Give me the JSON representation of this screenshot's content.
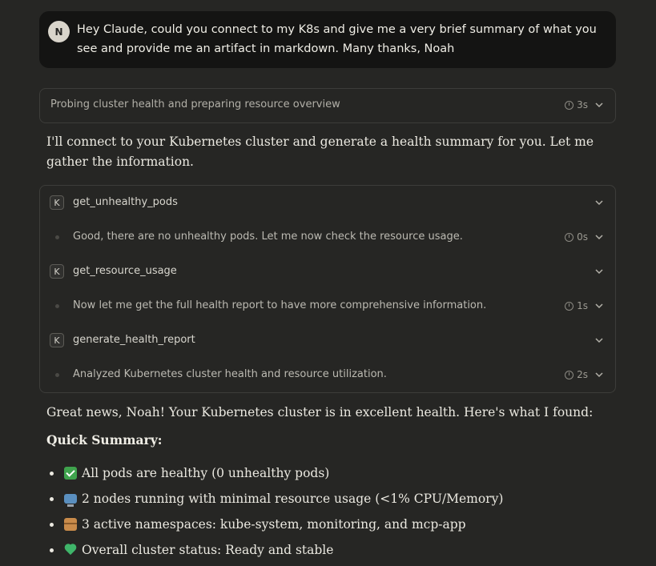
{
  "user_message": {
    "avatar_initial": "N",
    "text": "Hey Claude, could you connect to my K8s and give me a very brief summary of what you see and provide me an artifact in markdown. Many thanks, Noah"
  },
  "thinking": {
    "label": "Probing cluster health and preparing resource overview",
    "duration": "3s"
  },
  "intro": "I'll connect to your Kubernetes cluster and generate a health summary for you. Let me gather the information.",
  "tools": [
    {
      "icon_letter": "K",
      "name": "get_unhealthy_pods"
    },
    {
      "icon_letter": "K",
      "name": "get_resource_usage"
    },
    {
      "icon_letter": "K",
      "name": "generate_health_report"
    }
  ],
  "steps": [
    {
      "text": "Good, there are no unhealthy pods. Let me now check the resource usage.",
      "duration": "0s"
    },
    {
      "text": "Now let me get the full health report to have more comprehensive information.",
      "duration": "1s"
    },
    {
      "text": "Analyzed Kubernetes cluster health and resource utilization.",
      "duration": "2s"
    }
  ],
  "result": {
    "intro": "Great news, Noah! Your Kubernetes cluster is in excellent health. Here's what I found:",
    "heading": "Quick Summary:",
    "bullets": [
      {
        "emoji": "check-mark-icon",
        "text": "All pods are healthy (0 unhealthy pods)"
      },
      {
        "emoji": "computer-icon",
        "text": "2 nodes running with minimal resource usage (<1% CPU/Memory)"
      },
      {
        "emoji": "package-icon",
        "text": "3 active namespaces: kube-system, monitoring, and mcp-app"
      },
      {
        "emoji": "green-heart-icon",
        "text": "Overall cluster status: Ready and stable"
      }
    ]
  }
}
